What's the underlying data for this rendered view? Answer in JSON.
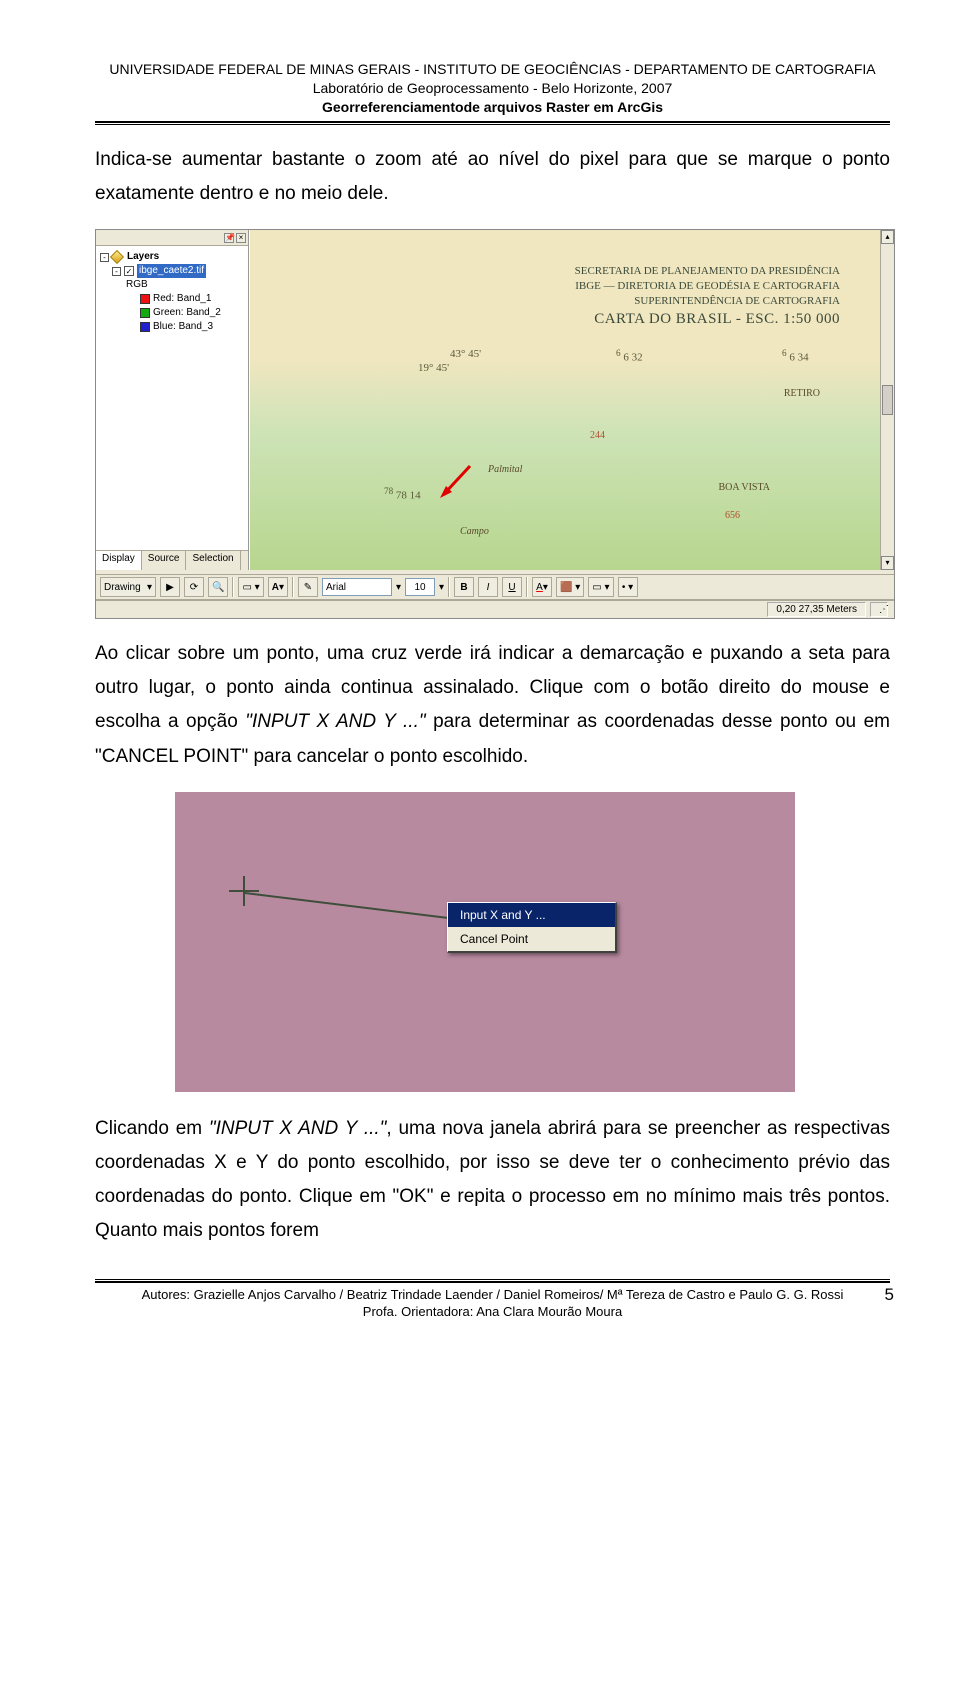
{
  "header": {
    "line1": "UNIVERSIDADE FEDERAL DE MINAS GERAIS - INSTITUTO DE GEOCIÊNCIAS - DEPARTAMENTO DE CARTOGRAFIA",
    "line2": "Laboratório de Geoprocessamento - Belo Horizonte, 2007",
    "line3": "Georreferenciamentode arquivos Raster em ArcGis"
  },
  "paragraphs": {
    "p1": "Indica-se aumentar bastante o zoom até ao nível do pixel para que se marque o ponto exatamente dentro e no meio dele.",
    "p2_a": "Ao clicar sobre um ponto, uma cruz verde irá indicar a demarcação e puxando a seta para outro lugar, o ponto ainda continua assinalado. Clique com o botão direito do mouse e escolha a opção ",
    "p2_i1": "\"INPUT X AND Y ...\"",
    "p2_b": " para determinar as coordenadas desse ponto ou em \"CANCEL POINT\" para cancelar o ponto escolhido.",
    "p3_a": "Clicando em ",
    "p3_i1": "\"INPUT X AND Y ...\"",
    "p3_b": ", uma nova janela abrirá para se preencher as respectivas coordenadas X e Y do ponto escolhido, por isso se deve ter o conhecimento prévio das coordenadas do ponto. Clique em \"OK\" e repita o processo em no mínimo mais três pontos. Quanto mais pontos forem"
  },
  "arcmap": {
    "toc": {
      "root": "Layers",
      "layer": "ibge_caete2.tif",
      "composite": "RGB",
      "bands": [
        "Red: Band_1",
        "Green: Band_2",
        "Blue: Band_3"
      ],
      "tabs": [
        "Display",
        "Source",
        "Selection"
      ]
    },
    "map": {
      "title_lines": [
        "SECRETARIA DE PLANEJAMENTO DA PRESIDÊNCIA",
        "IBGE — DIRETORIA DE GEODÉSIA E CARTOGRAFIA",
        "SUPERINTENDÊNCIA DE CARTOGRAFIA"
      ],
      "title_big": "CARTA DO BRASIL - ESC. 1:50 000",
      "coords": {
        "lon": "43° 45'",
        "lat": "19° 45'",
        "e1": "6 32",
        "e2": "6 34",
        "n1": "78 14"
      },
      "labels": {
        "retiro": "RETIRO",
        "boavista": "BOA VISTA",
        "campo": "Campo",
        "palmital": "Palmital",
        "h244": "244",
        "h656": "656"
      }
    },
    "toolbar": {
      "drawing": "Drawing",
      "font": "Arial",
      "size": "10",
      "buttons": {
        "b": "B",
        "i": "I",
        "u": "U",
        "a": "A"
      }
    },
    "status": "0,20 27,35 Meters"
  },
  "contextmenu": {
    "item1": "Input X and Y ...",
    "item2": "Cancel Point"
  },
  "footer": {
    "line1": "Autores: Grazielle Anjos Carvalho / Beatriz Trindade Laender / Daniel Romeiros/ Mª Tereza de Castro e Paulo G. G. Rossi",
    "line2": "Profa. Orientadora: Ana Clara Mourão Moura",
    "page": "5"
  }
}
